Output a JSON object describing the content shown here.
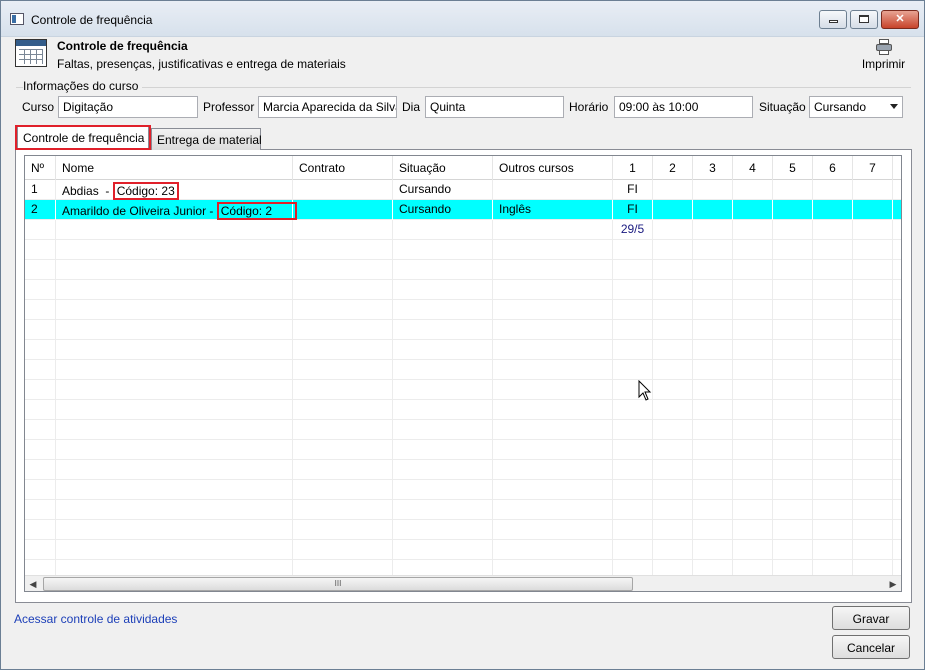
{
  "window": {
    "title": "Controle de frequência",
    "controls": {
      "minimize": "",
      "maximize": "",
      "close": "✕"
    }
  },
  "header": {
    "title": "Controle de frequência",
    "subtitle": "Faltas, presenças, justificativas e entrega de materiais",
    "print_label": "Imprimir"
  },
  "course_info": {
    "section_title": "Informações do curso",
    "curso_label": "Curso",
    "curso_value": "Digitação",
    "professor_label": "Professor",
    "professor_value": "Marcia Aparecida da Silva",
    "dia_label": "Dia",
    "dia_value": "Quinta",
    "horario_label": "Horário",
    "horario_value": "09:00 às 10:00",
    "situacao_label": "Situação",
    "situacao_value": "Cursando"
  },
  "tabs": [
    {
      "label": "Controle de frequência",
      "active": true
    },
    {
      "label": "Entrega de material",
      "active": false
    }
  ],
  "grid": {
    "columns": [
      "Nº",
      "Nome",
      "Contrato",
      "Situação",
      "Outros cursos",
      "1",
      "2",
      "3",
      "4",
      "5",
      "6",
      "7"
    ],
    "rows": [
      {
        "num": "1",
        "name": "Abdias  - ",
        "code": "Código: 23",
        "contrato": "",
        "situacao": "Cursando",
        "outros": "",
        "d1": "FI",
        "selected": false
      },
      {
        "num": "2",
        "name": "Amarildo de Oliveira Junior - ",
        "code": "Código: 2",
        "contrato": "",
        "situacao": "Cursando",
        "outros": "Inglês",
        "d1": "FI",
        "selected": true
      }
    ],
    "date_row": {
      "d1": "29/5"
    },
    "scrollbar_grip": "III"
  },
  "footer": {
    "link_text": "Acessar controle de atividades",
    "save_label": "Gravar",
    "cancel_label": "Cancelar"
  },
  "colors": {
    "selected_row": "#00ffff",
    "highlight_border": "#e0202a",
    "link": "#1c3fb8"
  }
}
